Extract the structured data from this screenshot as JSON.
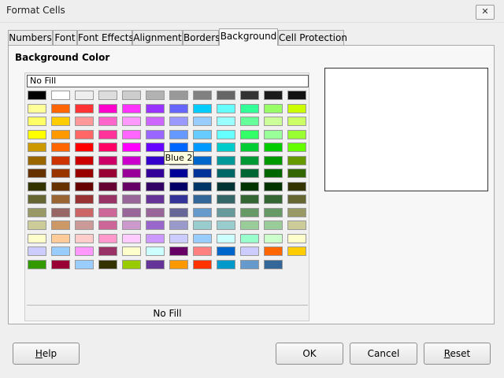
{
  "window": {
    "title": "Format Cells"
  },
  "tabs": [
    {
      "label": "Numbers"
    },
    {
      "label": "Font"
    },
    {
      "label": "Font Effects"
    },
    {
      "label": "Alignment"
    },
    {
      "label": "Borders"
    },
    {
      "label": "Background",
      "active": true
    },
    {
      "label": "Cell Protection"
    }
  ],
  "background": {
    "section_title": "Background Color",
    "selector_value": "No Fill",
    "selected_name": "No Fill",
    "tooltip": "Blue 2"
  },
  "palette": [
    [
      "#000000",
      "#ffffff",
      "#eeeeee",
      "#dddddd",
      "#cccccc",
      "#b2b2b2",
      "#999999",
      "#808080",
      "#666666",
      "#333333",
      "#1c1c1c",
      "#111111"
    ],
    [
      "#ffff99",
      "#ff6600",
      "#ff3333",
      "#ff00cc",
      "#ff33ff",
      "#9933ff",
      "#6666ff",
      "#00ccff",
      "#66ffff",
      "#33ff99",
      "#99ff66",
      "#ccff00"
    ],
    [
      "#ffff66",
      "#ffcc00",
      "#ff9999",
      "#ff66cc",
      "#ff99ff",
      "#cc66ff",
      "#9999ff",
      "#99ccff",
      "#99ffff",
      "#66ff99",
      "#ccff99",
      "#ccff66"
    ],
    [
      "#ffff00",
      "#ff9900",
      "#ff6666",
      "#ff3399",
      "#ff66ff",
      "#9966ff",
      "#6699ff",
      "#66ccff",
      "#66ffff",
      "#33ff66",
      "#99ff99",
      "#99ff33"
    ],
    [
      "#cc9900",
      "#ff6600",
      "#ff0000",
      "#ff0066",
      "#ff00ff",
      "#6600ff",
      "#0066ff",
      "#0099ff",
      "#00cccc",
      "#00cc33",
      "#00cc00",
      "#66ff00"
    ],
    [
      "#996600",
      "#cc3300",
      "#cc0000",
      "#cc0066",
      "#cc00cc",
      "#3300cc",
      "#0000ff",
      "#0066cc",
      "#009999",
      "#009933",
      "#009900",
      "#669900"
    ],
    [
      "#663300",
      "#993300",
      "#990000",
      "#990033",
      "#990099",
      "#330099",
      "#000099",
      "#003399",
      "#006666",
      "#006633",
      "#006600",
      "#336600"
    ],
    [
      "#333300",
      "#663300",
      "#660000",
      "#660033",
      "#660066",
      "#330066",
      "#000066",
      "#003366",
      "#003333",
      "#003300",
      "#003300",
      "#333300"
    ],
    [
      "#666633",
      "#996633",
      "#993333",
      "#993366",
      "#996699",
      "#663399",
      "#333399",
      "#336699",
      "#336666",
      "#336633",
      "#336633",
      "#666633"
    ],
    [
      "#999966",
      "#996666",
      "#cc6666",
      "#cc6699",
      "#996699",
      "#996699",
      "#666699",
      "#6699cc",
      "#669999",
      "#669966",
      "#669966",
      "#999966"
    ],
    [
      "#cccc99",
      "#cc9966",
      "#cc9999",
      "#cc6699",
      "#cc99cc",
      "#9966cc",
      "#9999cc",
      "#99cccc",
      "#99cccc",
      "#99cc99",
      "#99cc99",
      "#cccc99"
    ],
    [
      "#ffffcc",
      "#ffcc99",
      "#ffcccc",
      "#ff99cc",
      "#ffccff",
      "#cc99ff",
      "#ccccff",
      "#99ccff",
      "#ccffff",
      "#99ffcc",
      "#ccffcc",
      "#ffffcc"
    ],
    [
      "#ccccff",
      "#99ccff",
      "#ff99ff",
      "#993366",
      "#ffffcc",
      "#ccffff",
      "#660066",
      "#ff8080",
      "#0066cc",
      "#ccccff",
      "#ff6600",
      "#ffcc00"
    ],
    [
      "#339900",
      "#990033",
      "#99ccff",
      "#333300",
      "#99cc00",
      "#663399",
      "#ff9900",
      "#ff3300",
      "#0099cc",
      "#6699cc",
      "#336699"
    ]
  ],
  "buttons": {
    "help": {
      "label": "Help",
      "mnemonic": "H",
      "rest": "elp"
    },
    "ok": {
      "label": "OK"
    },
    "cancel": {
      "label": "Cancel"
    },
    "reset": {
      "label": "Reset",
      "mnemonic": "R",
      "rest": "eset"
    }
  }
}
